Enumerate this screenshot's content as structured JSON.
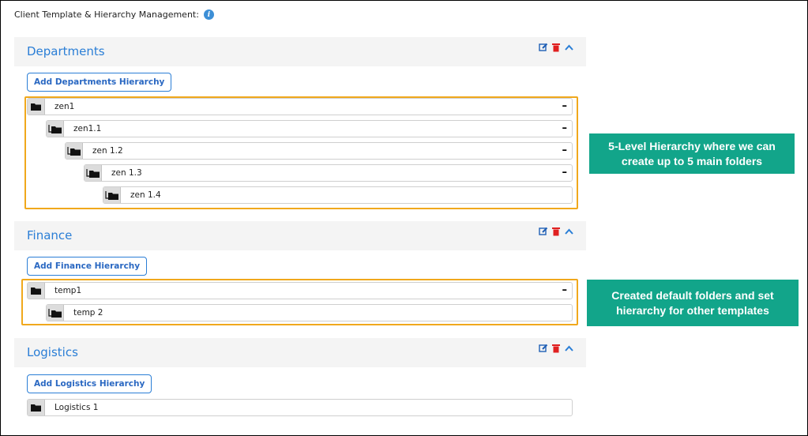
{
  "page": {
    "title": "Client Template & Hierarchy Management:",
    "info_icon": "info-icon"
  },
  "colors": {
    "accent": "#2a7ed6",
    "highlight": "#f0a81c",
    "callout_bg": "#12a58a",
    "delete": "#e02020"
  },
  "icons": {
    "edit": "edit-icon",
    "delete": "trash-icon",
    "collapse_section": "chevron-up-icon",
    "folder": "folder-icon",
    "child_folder": "child-folder-icon",
    "collapse_row": "minus-icon"
  },
  "sections": {
    "departments": {
      "title": "Departments",
      "add_label": "Add Departments Hierarchy",
      "rows": [
        {
          "label": "zen1",
          "collapsible": "–"
        },
        {
          "label": "zen1.1",
          "collapsible": "–"
        },
        {
          "label": "zen 1.2",
          "collapsible": "–"
        },
        {
          "label": "zen 1.3",
          "collapsible": "–"
        },
        {
          "label": "zen 1.4"
        }
      ]
    },
    "finance": {
      "title": "Finance",
      "add_label": "Add Finance Hierarchy",
      "rows": [
        {
          "label": "temp1",
          "collapsible": "–"
        },
        {
          "label": "temp 2"
        }
      ]
    },
    "logistics": {
      "title": "Logistics",
      "add_label": "Add Logistics Hierarchy",
      "rows": [
        {
          "label": "Logistics 1"
        }
      ]
    }
  },
  "callouts": {
    "hierarchy_note": "5-Level Hierarchy where we can create up to 5 main folders",
    "defaults_note": "Created default folders and set hierarchy for other templates"
  }
}
